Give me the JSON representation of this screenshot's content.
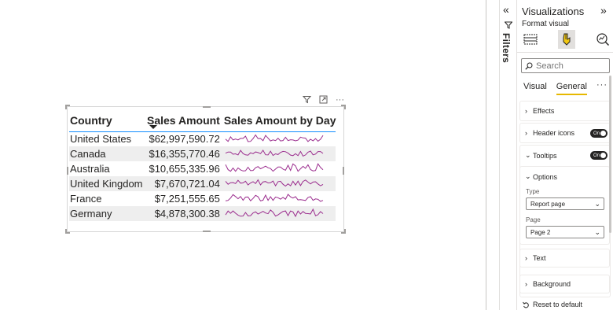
{
  "table": {
    "columns": [
      "Country",
      "Sales Amount",
      "Sales Amount by Day"
    ],
    "sorted_column_index": 1,
    "rows": [
      {
        "country": "United States",
        "sales": "$62,997,590.72"
      },
      {
        "country": "Canada",
        "sales": "$16,355,770.46"
      },
      {
        "country": "Australia",
        "sales": "$10,655,335.96"
      },
      {
        "country": "United Kingdom",
        "sales": "$7,670,721.04"
      },
      {
        "country": "France",
        "sales": "$7,251,555.65"
      },
      {
        "country": "Germany",
        "sales": "$4,878,300.38"
      }
    ],
    "sparkline_color": "#9b2d8e"
  },
  "visual_header": {
    "icons": [
      "filter-icon",
      "focus-mode-icon",
      "more-options-icon"
    ],
    "more_label": "···"
  },
  "rail": {
    "collapse_glyph": "«",
    "filters_label": "Filters"
  },
  "pane": {
    "title": "Visualizations",
    "expand_glyph": "»",
    "subtitle": "Format visual",
    "search_placeholder": "Search",
    "tabs": [
      {
        "label": "Visual",
        "active": false
      },
      {
        "label": "General",
        "active": true
      }
    ],
    "more_glyph": "···",
    "sections": {
      "effects": "Effects",
      "header_icons": "Header icons",
      "tooltips": "Tooltips",
      "options": "Options",
      "type_label": "Type",
      "type_value": "Report page",
      "page_label": "Page",
      "page_value": "Page 2",
      "text": "Text",
      "background": "Background"
    },
    "toggle_on": "On",
    "reset_label": "Reset to default",
    "accent_color": "#e6b800"
  }
}
